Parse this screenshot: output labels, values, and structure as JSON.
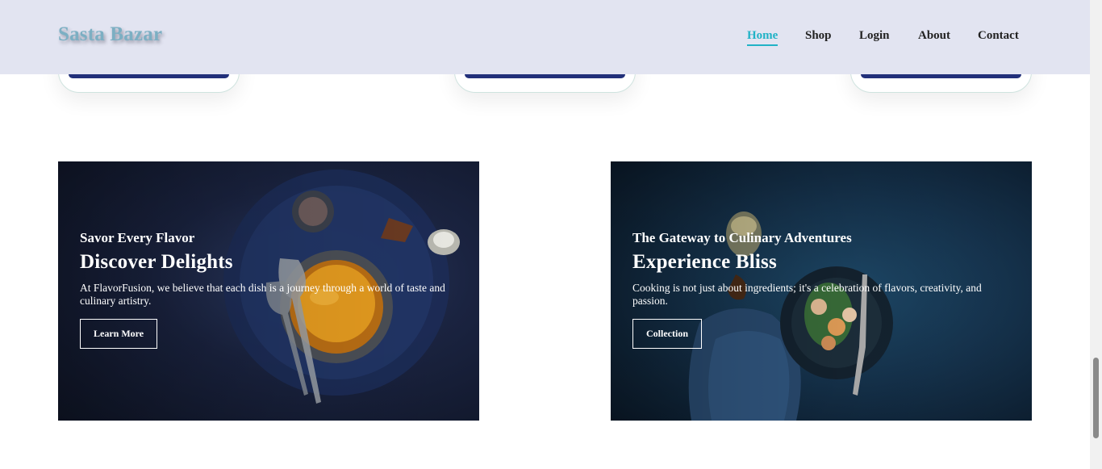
{
  "header": {
    "brand": "Sasta Bazar",
    "nav": [
      {
        "label": "Home",
        "active": true
      },
      {
        "label": "Shop",
        "active": false
      },
      {
        "label": "Login",
        "active": false
      },
      {
        "label": "About",
        "active": false
      },
      {
        "label": "Contact",
        "active": false
      }
    ]
  },
  "banners": [
    {
      "eyebrow": "Savor Every Flavor",
      "headline": "Discover Delights",
      "description": "At FlavorFusion, we believe that each dish is a journey through a world of taste and culinary artistry.",
      "button": "Learn More"
    },
    {
      "eyebrow": "The Gateway to Culinary Adventures",
      "headline": "Experience Bliss",
      "description": "Cooking is not just about ingredients; it's a celebration of flavors, creativity, and passion.",
      "button": "Collection"
    }
  ],
  "colors": {
    "navbar_bg": "#e2e4f1",
    "brand": "#7cafc3",
    "nav_active": "#20b2c6",
    "card_bar": "#22307a"
  }
}
